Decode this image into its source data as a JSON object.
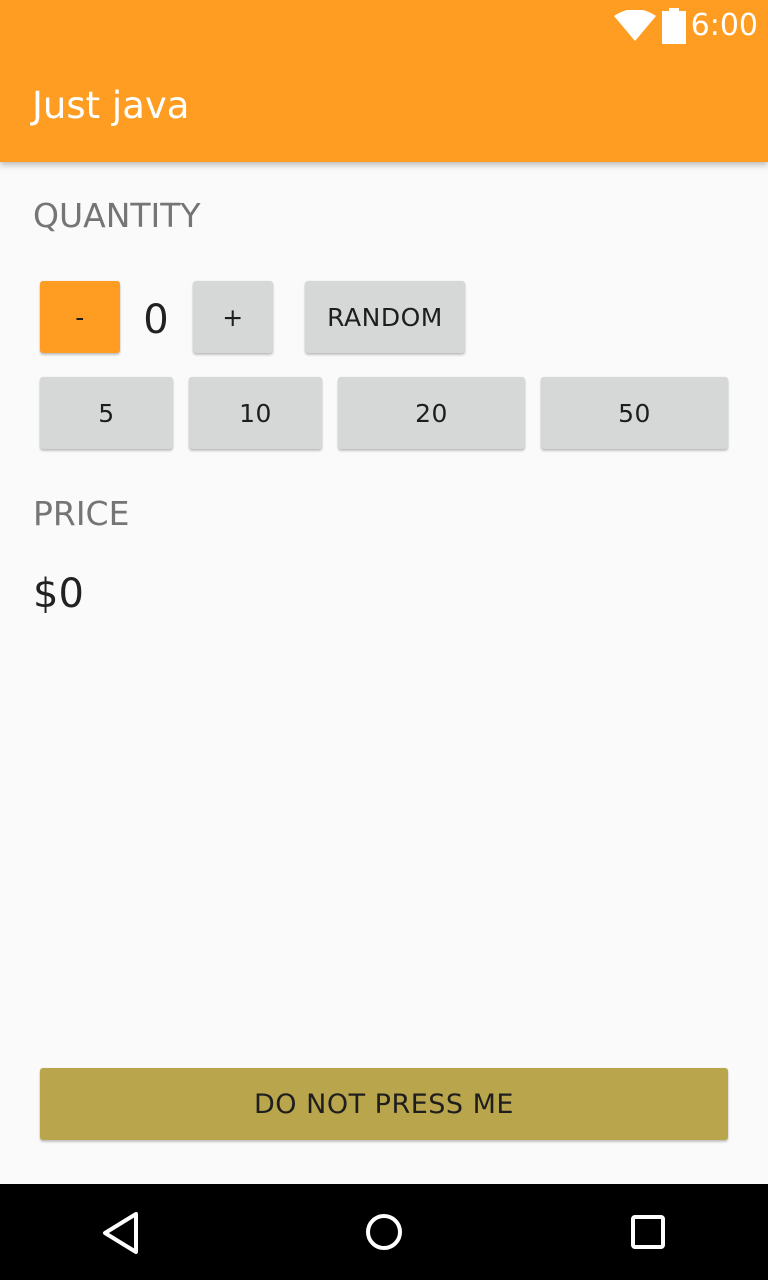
{
  "status_bar": {
    "time": "6:00",
    "icons": [
      "wifi-icon",
      "battery-icon"
    ]
  },
  "app_bar": {
    "title": "Just java"
  },
  "quantity": {
    "label": "QUANTITY",
    "value": "0",
    "decrement_label": "-",
    "increment_label": "+",
    "random_label": "RANDOM",
    "presets": [
      "5",
      "10",
      "20",
      "50"
    ]
  },
  "price": {
    "label": "PRICE",
    "value": "$0"
  },
  "actions": {
    "do_not_press_label": "DO NOT PRESS ME"
  },
  "nav_bar": {
    "icons": [
      "back-icon",
      "home-icon",
      "recents-icon"
    ]
  },
  "colors": {
    "primary": "#ff9d22",
    "button_default": "#d6d7d7",
    "button_gold": "#b9a64c",
    "background": "#fafafa"
  }
}
